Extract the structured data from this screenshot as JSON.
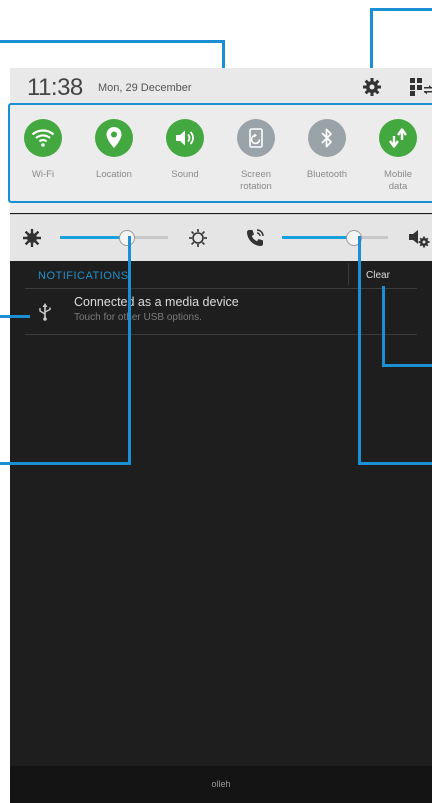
{
  "status_bar": {
    "time": "11:38",
    "date": "Mon, 29 December"
  },
  "quick_settings": [
    {
      "label": "Wi-Fi",
      "icon": "wifi-icon",
      "active": true
    },
    {
      "label": "Location",
      "icon": "location-pin-icon",
      "active": true
    },
    {
      "label": "Sound",
      "icon": "volume-icon",
      "active": true
    },
    {
      "label": "Screen\nrotation",
      "icon": "screen-rotation-icon",
      "active": false
    },
    {
      "label": "Bluetooth",
      "icon": "bluetooth-icon",
      "active": false
    },
    {
      "label": "Mobile\ndata",
      "icon": "mobile-data-icon",
      "active": true
    }
  ],
  "sliders": {
    "brightness_level": 0.62,
    "volume_level": 0.68
  },
  "notifications": {
    "header": "NOTIFICATIONS",
    "clear_label": "Clear",
    "items": [
      {
        "title": "Connected as a media device",
        "subtitle": "Touch for other USB options.",
        "icon": "usb-icon"
      }
    ]
  },
  "carrier": "olleh",
  "colors": {
    "active_green": "#43a83f",
    "inactive_gray": "#9aa3a8",
    "accent_blue": "#1a8fd4"
  }
}
